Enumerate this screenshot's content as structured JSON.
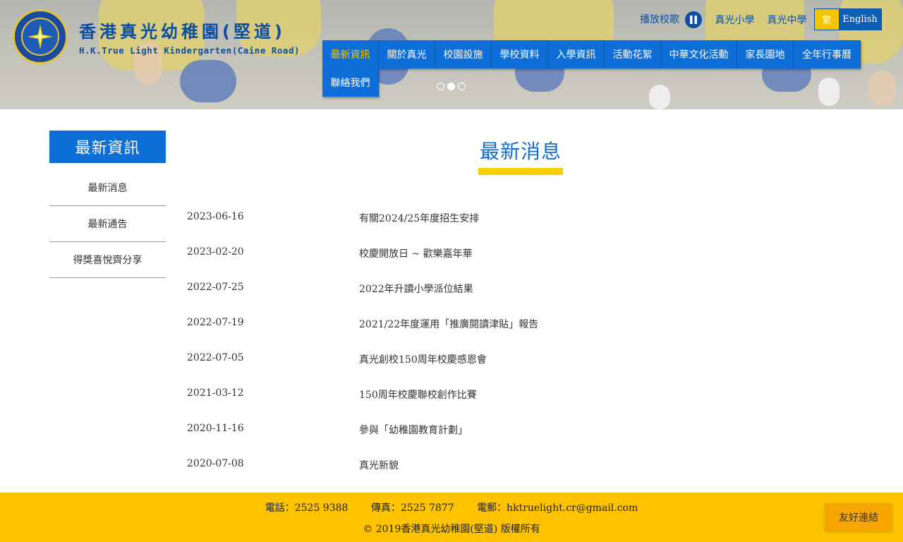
{
  "header": {
    "logo_cn": "香港真光幼稚園(堅道)",
    "logo_en": "H.K.True Light Kindergarten(Caine Road)",
    "play_song": "播放校歌",
    "link_primary": "真光小學",
    "link_secondary": "真光中學",
    "lang_trad": "繁",
    "lang_en": "English"
  },
  "nav": {
    "items": [
      "最新資訊",
      "關於真光",
      "校園設施",
      "學校資料",
      "入學資訊",
      "活動花絮",
      "中華文化活動",
      "家長園地",
      "全年行事曆",
      "聯絡我們"
    ],
    "active_index": 0
  },
  "sidebar": {
    "title": "最新資訊",
    "items": [
      "最新消息",
      "最新通告",
      "得獎喜悅齊分享"
    ]
  },
  "main": {
    "title": "最新消息",
    "news": [
      {
        "date": "2023-06-16",
        "title": "有關2024/25年度招生安排"
      },
      {
        "date": "2023-02-20",
        "title": "校慶開放日 ~ 歡樂嘉年華"
      },
      {
        "date": "2022-07-25",
        "title": "2022年升讀小學派位結果"
      },
      {
        "date": "2022-07-19",
        "title": "2021/22年度運用「推廣閱讀津貼」報告"
      },
      {
        "date": "2022-07-05",
        "title": "真光創校150周年校慶感恩會"
      },
      {
        "date": "2021-03-12",
        "title": "150周年校慶聯校創作比賽"
      },
      {
        "date": "2020-11-16",
        "title": "參與「幼稚園教育計劃」"
      },
      {
        "date": "2020-07-08",
        "title": "真光新貌"
      }
    ]
  },
  "footer": {
    "phone": "電話：2525 9388",
    "fax": "傳真：2525 7877",
    "email": "電郵：hktruelight.cr@gmail.com",
    "copyright": "© 2019香港真光幼稚園(堅道) 版權所有",
    "friend_links": "友好連結"
  },
  "colors": {
    "brand_blue": "#0d6ed8",
    "accent_yellow": "#fdc300",
    "logo_blue": "#0b4ea2"
  },
  "icons": [
    "pause-icon",
    "school-logo",
    "slide-dot"
  ]
}
